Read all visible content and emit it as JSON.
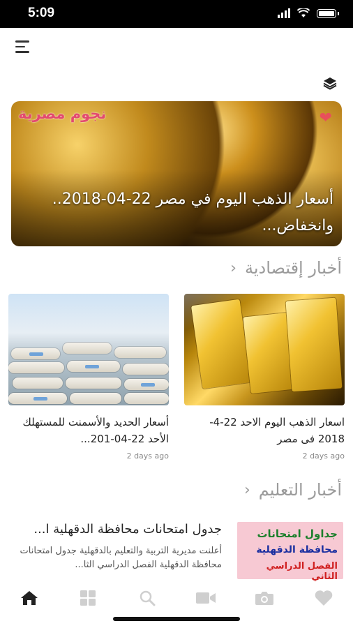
{
  "status_bar": {
    "time": "5:09"
  },
  "hero": {
    "brand": "نجوم مصرية",
    "title": "أسعار الذهب اليوم في مصر 22-04-2018.. وانخفاض..."
  },
  "sections": [
    {
      "title": "أخبار إقتصادية"
    },
    {
      "title": "أخبار التعليم"
    }
  ],
  "economy_cards": [
    {
      "title": "اسعار الذهب اليوم الاحد 22-4-2018 فى مصر",
      "time": "2 days ago"
    },
    {
      "title": "أسعار الحديد والأسمنت للمستهلك الأحد 22-04-201...",
      "time": "2 days ago"
    }
  ],
  "education_item": {
    "title": "جدول امتحانات محافظة الدقهلية ا...",
    "excerpt": "أعلنت مديرية التربية والتعليم بالدقهلية جدول امتحانات محافظة الدقهلية الفصل الدراسي الثا...",
    "thumb_lines": [
      "جداول امتحانات",
      "محافظة الدقهلية",
      "الفصل الدراسي الثاني"
    ]
  },
  "tabbar": [
    {
      "icon": "home-icon",
      "active": true
    },
    {
      "icon": "grid-icon",
      "active": false
    },
    {
      "icon": "search-icon",
      "active": false
    },
    {
      "icon": "video-icon",
      "active": false
    },
    {
      "icon": "camera-icon",
      "active": false
    },
    {
      "icon": "heart-icon",
      "active": false
    }
  ],
  "colors": {
    "active": "#222222",
    "inactive": "#cfcfcf",
    "accent": "#e8505b"
  }
}
